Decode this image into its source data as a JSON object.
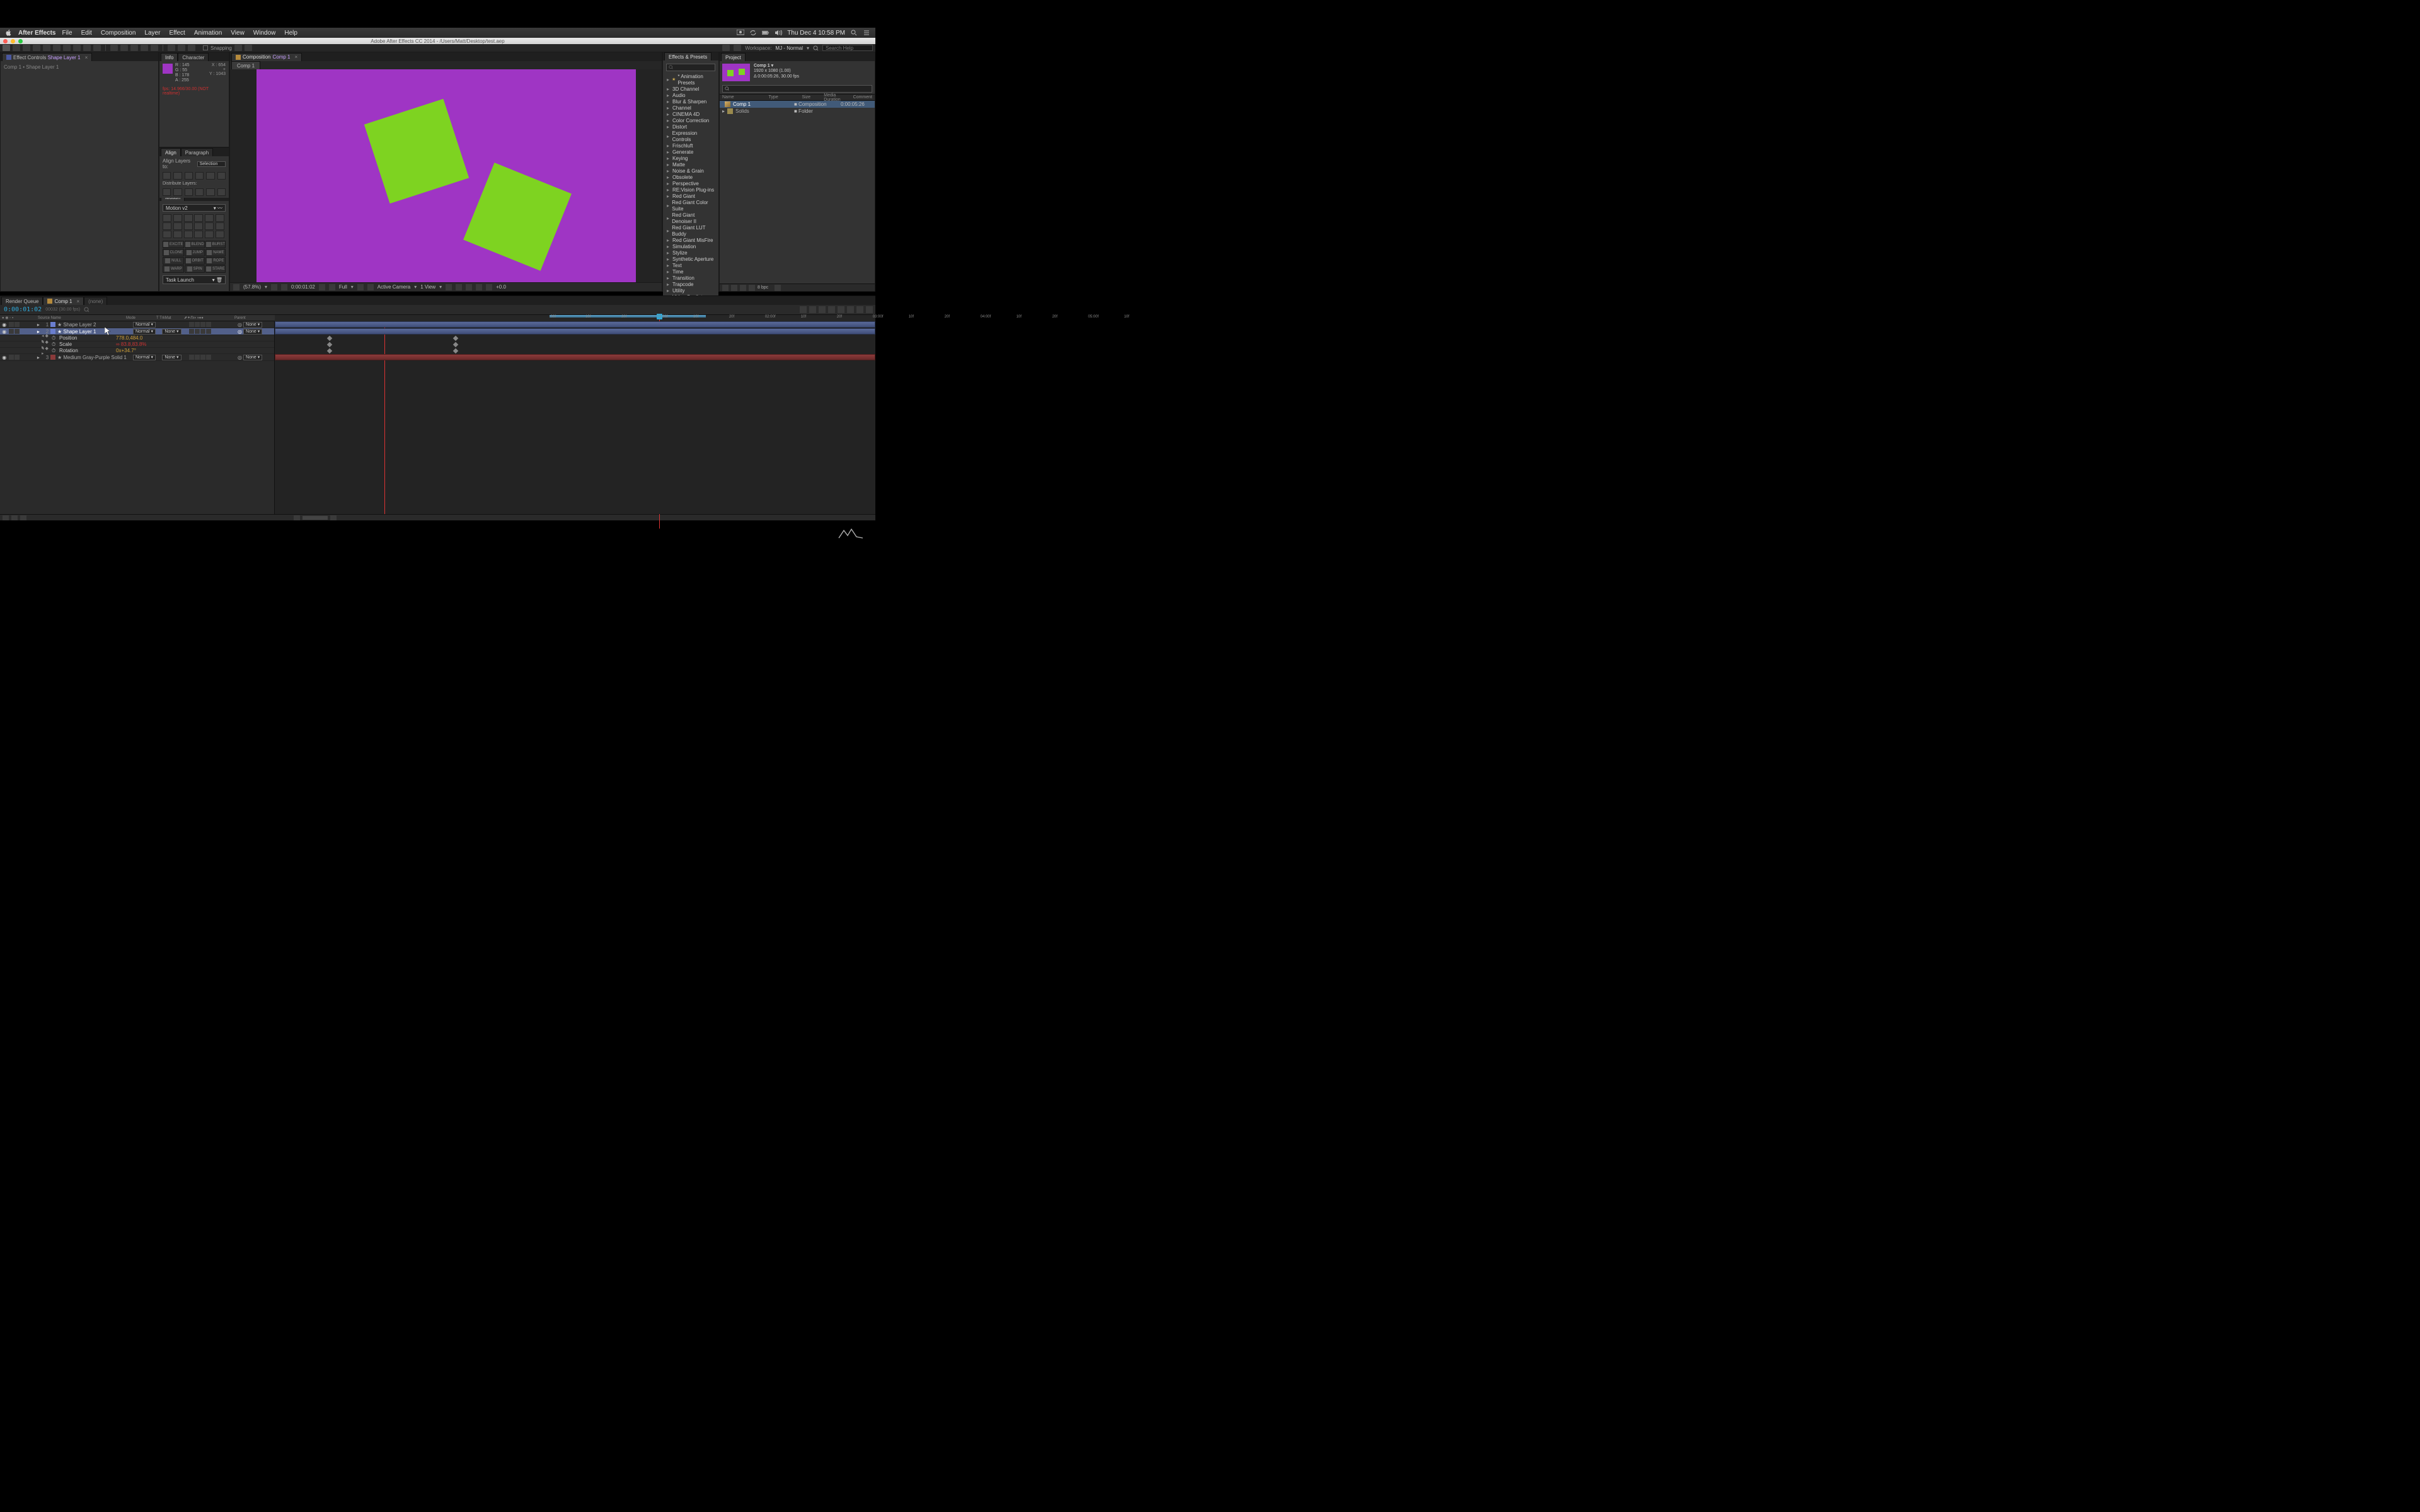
{
  "mac_menu": {
    "app": "After Effects",
    "items": [
      "File",
      "Edit",
      "Composition",
      "Layer",
      "Effect",
      "Animation",
      "View",
      "Window",
      "Help"
    ],
    "clock": "Thu Dec 4  10:58 PM"
  },
  "window_title": "Adobe After Effects CC 2014 - /Users/Matt/Desktop/test.aep",
  "toolbar": {
    "snapping_label": "Snapping",
    "workspace_label": "Workspace:",
    "workspace_value": "MJ - Normal",
    "search_placeholder": "Search Help"
  },
  "effect_controls": {
    "tab": "Effect Controls",
    "layer": "Shape Layer 1",
    "path": "Comp 1 • Shape Layer 1"
  },
  "info": {
    "tab_info": "Info",
    "tab_character": "Character",
    "R": "R : 145",
    "G": "G : 55",
    "B": "B : 178",
    "A": "A : 255",
    "X": "X : 654",
    "Y": "Y : 1043",
    "fps_warning": "fps: 14.966/30.00 (NOT realtime)"
  },
  "align": {
    "tab_align": "Align",
    "tab_paragraph": "Paragraph",
    "align_to_label": "Align Layers to:",
    "align_to_value": "Selection",
    "distribute_label": "Distribute Layers:"
  },
  "motion": {
    "tab": "Motion",
    "preset": "Motion v2",
    "buttons": [
      "EXCITE",
      "BLEND",
      "BURST",
      "CLONE",
      "JUMP",
      "NAME",
      "NULL",
      "ORBIT",
      "ROPE",
      "WARP",
      "SPIN",
      "STARE"
    ],
    "task_launch": "Task Launch"
  },
  "composition": {
    "tab": "Composition",
    "name": "Comp 1",
    "sub_tab": "Comp 1",
    "footer": {
      "zoom": "(57.8%)",
      "timecode": "0:00:01:02",
      "res": "Full",
      "camera": "Active Camera",
      "views": "1 View",
      "exposure": "+0.0"
    }
  },
  "effects_presets": {
    "tab": "Effects & Presets",
    "categories": [
      "* Animation Presets",
      "3D Channel",
      "Audio",
      "Blur & Sharpen",
      "Channel",
      "CINEMA 4D",
      "Color Correction",
      "Distort",
      "Expression Controls",
      "Frischluft",
      "Generate",
      "Keying",
      "Matte",
      "Noise & Grain",
      "Obsolete",
      "Perspective",
      "RE:Vision Plug-ins",
      "Red Giant",
      "Red Giant Color Suite",
      "Red Giant Denoiser II",
      "Red Giant LUT Buddy",
      "Red Giant MisFire",
      "Simulation",
      "Stylize",
      "Synthetic Aperture",
      "Text",
      "Time",
      "Transition",
      "Trapcode",
      "Utility",
      "Video Copilot"
    ]
  },
  "project": {
    "tab": "Project",
    "selected": {
      "name": "Comp 1 ▾",
      "dims": "1920 x 1080 (1.00)",
      "dur_fps": "Δ 0:00:05:26, 30.00 fps"
    },
    "cols": [
      "Name",
      "Type",
      "Size",
      "Media Duration",
      "Comment"
    ],
    "rows": [
      {
        "name": "Comp 1",
        "type": "Composition",
        "dur": "0:00:05:26",
        "kind": "comp",
        "sel": true
      },
      {
        "name": "Solids",
        "type": "Folder",
        "dur": "",
        "kind": "folder",
        "sel": false
      }
    ],
    "bpc": "8 bpc"
  },
  "timeline": {
    "tabs": {
      "render_queue": "Render Queue",
      "comp": "Comp 1",
      "none": "(none)"
    },
    "timecode": "0:00:01:02",
    "timecode_sub": "00032 (30.00 fps)",
    "col_headers": {
      "source": "Source Name",
      "mode": "Mode",
      "trkmat": "TrkMat",
      "parent": "Parent"
    },
    "ruler_ticks": [
      ":00f",
      "10f",
      "20f",
      "01:00f",
      "10f",
      "20f",
      "02:00f",
      "10f",
      "20f",
      "03:00f",
      "10f",
      "20f",
      "04:00f",
      "10f",
      "20f",
      "05:00f",
      "10f"
    ],
    "layers": [
      {
        "num": "1",
        "name": "Shape Layer 2",
        "mode": "Normal",
        "trk": "",
        "parent": "None",
        "color": "#6a7ecf",
        "sel": false
      },
      {
        "num": "2",
        "name": "Shape Layer 1",
        "mode": "Normal",
        "trk": "None",
        "parent": "None",
        "color": "#6a7ecf",
        "sel": true,
        "props": [
          {
            "name": "Position",
            "value": "778.0,484.0",
            "sel": false
          },
          {
            "name": "Scale",
            "value": "∞ 83.8,83.8%",
            "sel": true
          },
          {
            "name": "Rotation",
            "value": "0x+34.7°",
            "sel": false
          }
        ]
      },
      {
        "num": "3",
        "name": "Medium Gray-Purple Solid 1",
        "mode": "Normal",
        "trk": "None",
        "parent": "None",
        "color": "#8a3a3a",
        "sel": false
      }
    ]
  }
}
